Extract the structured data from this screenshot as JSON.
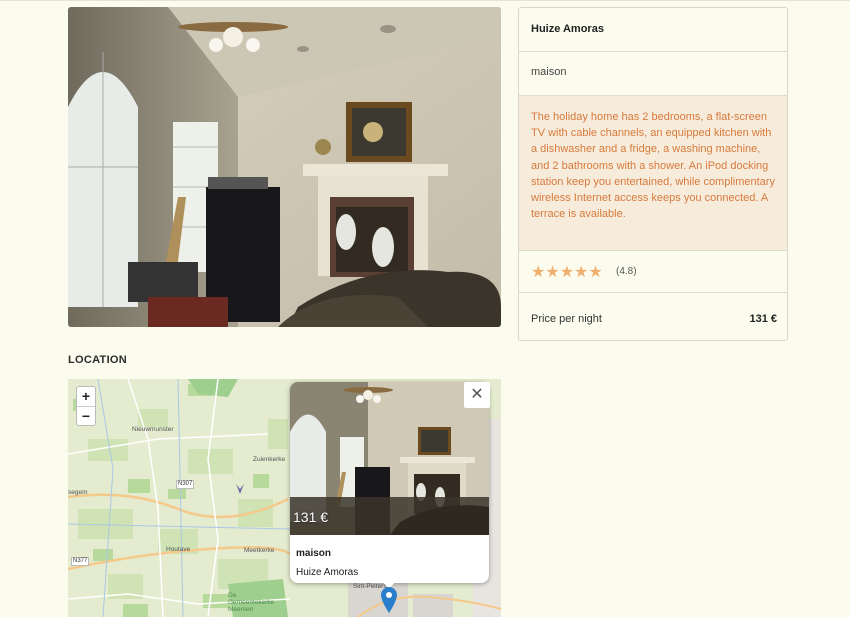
{
  "listing": {
    "title": "Huize Amoras",
    "type": "maison",
    "description": "The holiday home has 2 bedrooms, a flat-screen TV with cable channels, an equipped kitchen with a dishwasher and a fridge, a washing machine, and 2 bathrooms with a shower. An iPod docking station keep you entertained, while complimentary wireless Internet access keeps you connected. A terrace is available.",
    "stars": "★★★★★",
    "rating_value": 4.8,
    "rating_text": "(4.8)",
    "price_label": "Price per night",
    "price_value": "131 €"
  },
  "location": {
    "heading": "LOCATION",
    "zoom_in": "+",
    "zoom_out": "−",
    "towns": [
      "Nieuwmunster",
      "Zuienkerke",
      "Houtave",
      "Meetkerke",
      "segem",
      "De Gemeentekerke Meersen",
      "Sint-Pieters"
    ],
    "roads": [
      "N307",
      "N377"
    ],
    "popup": {
      "price": "131 €",
      "type": "maison",
      "name": "Huize Amoras",
      "close": "✕"
    }
  },
  "colors": {
    "background": "#fcfcee",
    "description_bg": "#f7ecdc",
    "description_text": "#d67a3c",
    "star": "#f0b070",
    "marker": "#2a7fcc"
  }
}
